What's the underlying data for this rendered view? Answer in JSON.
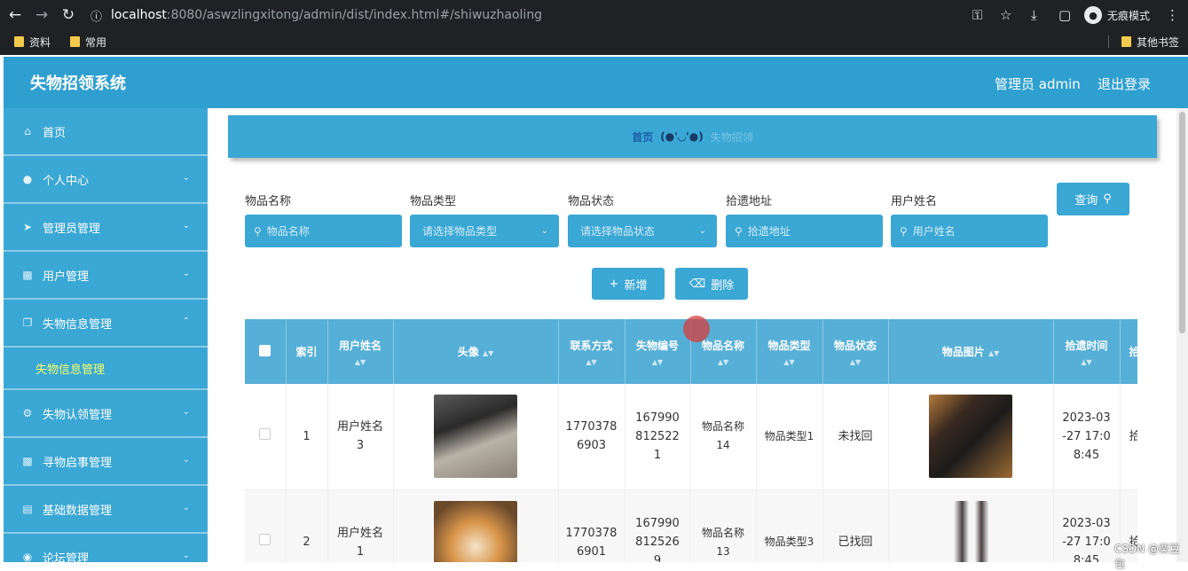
{
  "browser": {
    "url_host": "localhost",
    "url_rest": ":8080/aswzlingxitong/admin/dist/index.html#/shiwuzhaoling",
    "profile_label": "无痕模式",
    "bookmarks": [
      "资料",
      "常用"
    ],
    "other_bookmarks": "其他书签"
  },
  "header": {
    "title": "失物招领系统",
    "user": "管理员 admin",
    "logout": "退出登录"
  },
  "sidebar": {
    "items": [
      {
        "label": "首页",
        "icon": "home-icon"
      },
      {
        "label": "个人中心",
        "icon": "user-icon"
      },
      {
        "label": "管理员管理",
        "icon": "send-icon"
      },
      {
        "label": "用户管理",
        "icon": "monitor-icon"
      },
      {
        "label": "失物信息管理",
        "icon": "copy-icon"
      },
      {
        "label": "失物认领管理",
        "icon": "settings-icon"
      },
      {
        "label": "寻物启事管理",
        "icon": "monitor-icon"
      },
      {
        "label": "基础数据管理",
        "icon": "chat-icon"
      },
      {
        "label": "论坛管理",
        "icon": "lock-icon"
      }
    ],
    "active_sub": "失物信息管理"
  },
  "breadcrumb": {
    "home": "首页",
    "face": "(●'◡'●)",
    "current": "失物招领"
  },
  "filters": [
    {
      "label": "物品名称",
      "placeholder": "物品名称",
      "type": "input"
    },
    {
      "label": "物品类型",
      "placeholder": "请选择物品类型",
      "type": "select"
    },
    {
      "label": "物品状态",
      "placeholder": "请选择物品状态",
      "type": "select"
    },
    {
      "label": "拾遗地址",
      "placeholder": "拾遗地址",
      "type": "input"
    },
    {
      "label": "用户姓名",
      "placeholder": "用户姓名",
      "type": "input"
    }
  ],
  "buttons": {
    "query": "查询",
    "add": "新增",
    "delete": "删除"
  },
  "table": {
    "headers": [
      "索引",
      "用户姓名",
      "头像",
      "联系方式",
      "失物编号",
      "物品名称",
      "物品类型",
      "物品状态",
      "物品图片",
      "拾遗时间",
      "拾"
    ],
    "rows": [
      {
        "index": "1",
        "user": "用户姓名3",
        "phone": "17703786903",
        "code": "1679908125221",
        "name": "物品名称14",
        "type": "物品类型1",
        "status": "未找回",
        "time": "2023-03-27 17:08:45",
        "extra": "拾"
      },
      {
        "index": "2",
        "user": "用户姓名1",
        "phone": "17703786901",
        "code": "1679908125269",
        "name": "物品名称13",
        "type": "物品类型3",
        "status": "已找回",
        "time": "2023-03-27 17:08:45",
        "extra": "拾"
      }
    ]
  },
  "watermark": "CSDN @栗豆包",
  "colors": {
    "primary": "#3aa7d4",
    "header": "#2f9fd0",
    "active_sub": "#f6ff6a"
  }
}
